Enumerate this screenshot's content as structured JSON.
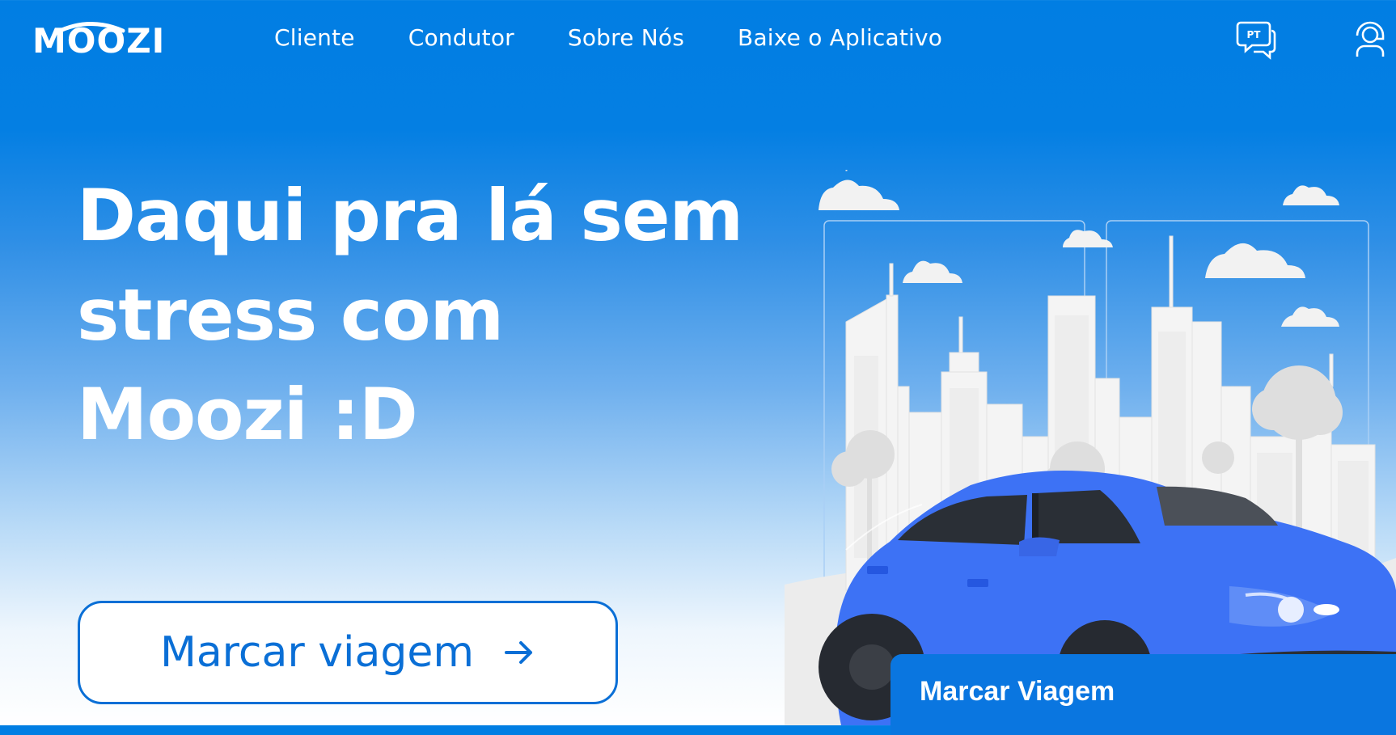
{
  "brand": {
    "logo_text": "MOOZI"
  },
  "nav": {
    "links": [
      {
        "label": "Cliente"
      },
      {
        "label": "Condutor"
      },
      {
        "label": "Sobre Nós"
      },
      {
        "label": "Baixe o Aplicativo"
      }
    ],
    "language_badge": "PT"
  },
  "hero": {
    "title_lines": [
      "Daqui pra lá sem",
      "stress com",
      "Moozi :D"
    ],
    "cta_label": "Marcar viagem"
  },
  "floating_panel": {
    "label": "Marcar Viagem"
  },
  "icons": {
    "language": "language-chat-icon",
    "account": "user-account-icon",
    "cta_arrow": "arrow-right-icon"
  },
  "colors": {
    "brand_blue": "#017ee3",
    "cta_border": "#0a6fd6",
    "car_blue": "#3d72f5",
    "panel_blue": "#0a76e0"
  }
}
